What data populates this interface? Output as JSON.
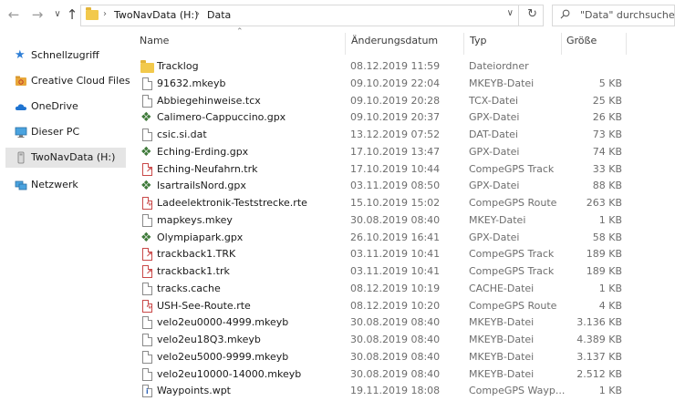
{
  "address": {
    "crumbs": [
      "TwoNavData (H:)",
      "Data"
    ],
    "search_placeholder": "\"Data\" durchsuchen"
  },
  "sidebar": {
    "items": [
      {
        "label": "Schnellzugriff",
        "icon": "star-icon"
      },
      {
        "label": "Creative Cloud Files",
        "icon": "creative-cloud-icon"
      },
      {
        "label": "OneDrive",
        "icon": "cloud-icon"
      },
      {
        "label": "Dieser PC",
        "icon": "computer-icon"
      },
      {
        "label": "TwoNavData (H:)",
        "icon": "drive-icon"
      },
      {
        "label": "Netzwerk",
        "icon": "network-icon"
      }
    ]
  },
  "columns": {
    "name": "Name",
    "date": "Änderungsdatum",
    "type": "Typ",
    "size": "Größe"
  },
  "files": [
    {
      "name": "Tracklog",
      "date": "08.12.2019 11:59",
      "type": "Dateiordner",
      "size": "",
      "icon": "folder"
    },
    {
      "name": "91632.mkeyb",
      "date": "09.10.2019 22:04",
      "type": "MKEYB-Datei",
      "size": "5 KB",
      "icon": "doc"
    },
    {
      "name": "Abbiegehinweise.tcx",
      "date": "09.10.2019 20:28",
      "type": "TCX-Datei",
      "size": "25 KB",
      "icon": "doc"
    },
    {
      "name": "Calimero-Cappuccino.gpx",
      "date": "09.10.2019 20:37",
      "type": "GPX-Datei",
      "size": "26 KB",
      "icon": "gpx"
    },
    {
      "name": "csic.si.dat",
      "date": "13.12.2019 07:52",
      "type": "DAT-Datei",
      "size": "73 KB",
      "icon": "doc"
    },
    {
      "name": "Eching-Erding.gpx",
      "date": "17.10.2019 13:47",
      "type": "GPX-Datei",
      "size": "74 KB",
      "icon": "gpx"
    },
    {
      "name": "Eching-Neufahrn.trk",
      "date": "17.10.2019 10:44",
      "type": "CompeGPS Track",
      "size": "33 KB",
      "icon": "track"
    },
    {
      "name": "IsartrailsNord.gpx",
      "date": "03.11.2019 08:50",
      "type": "GPX-Datei",
      "size": "88 KB",
      "icon": "gpx"
    },
    {
      "name": "Ladeelektronik-Teststrecke.rte",
      "date": "15.10.2019 15:02",
      "type": "CompeGPS Route",
      "size": "263 KB",
      "icon": "route"
    },
    {
      "name": "mapkeys.mkey",
      "date": "30.08.2019 08:40",
      "type": "MKEY-Datei",
      "size": "1 KB",
      "icon": "doc"
    },
    {
      "name": "Olympiapark.gpx",
      "date": "26.10.2019 16:41",
      "type": "GPX-Datei",
      "size": "58 KB",
      "icon": "gpx"
    },
    {
      "name": "trackback1.TRK",
      "date": "03.11.2019 10:41",
      "type": "CompeGPS Track",
      "size": "189 KB",
      "icon": "track"
    },
    {
      "name": "trackback1.trk",
      "date": "03.11.2019 10:41",
      "type": "CompeGPS Track",
      "size": "189 KB",
      "icon": "track"
    },
    {
      "name": "tracks.cache",
      "date": "08.12.2019 10:19",
      "type": "CACHE-Datei",
      "size": "1 KB",
      "icon": "doc"
    },
    {
      "name": "USH-See-Route.rte",
      "date": "08.12.2019 10:20",
      "type": "CompeGPS Route",
      "size": "4 KB",
      "icon": "route"
    },
    {
      "name": "velo2eu0000-4999.mkeyb",
      "date": "30.08.2019 08:40",
      "type": "MKEYB-Datei",
      "size": "3.136 KB",
      "icon": "doc"
    },
    {
      "name": "velo2eu18Q3.mkeyb",
      "date": "30.08.2019 08:40",
      "type": "MKEYB-Datei",
      "size": "4.389 KB",
      "icon": "doc"
    },
    {
      "name": "velo2eu5000-9999.mkeyb",
      "date": "30.08.2019 08:40",
      "type": "MKEYB-Datei",
      "size": "3.137 KB",
      "icon": "doc"
    },
    {
      "name": "velo2eu10000-14000.mkeyb",
      "date": "30.08.2019 08:40",
      "type": "MKEYB-Datei",
      "size": "2.512 KB",
      "icon": "doc"
    },
    {
      "name": "Waypoints.wpt",
      "date": "19.11.2019 18:08",
      "type": "CompeGPS Wayp...",
      "size": "1 KB",
      "icon": "waypoint"
    }
  ]
}
